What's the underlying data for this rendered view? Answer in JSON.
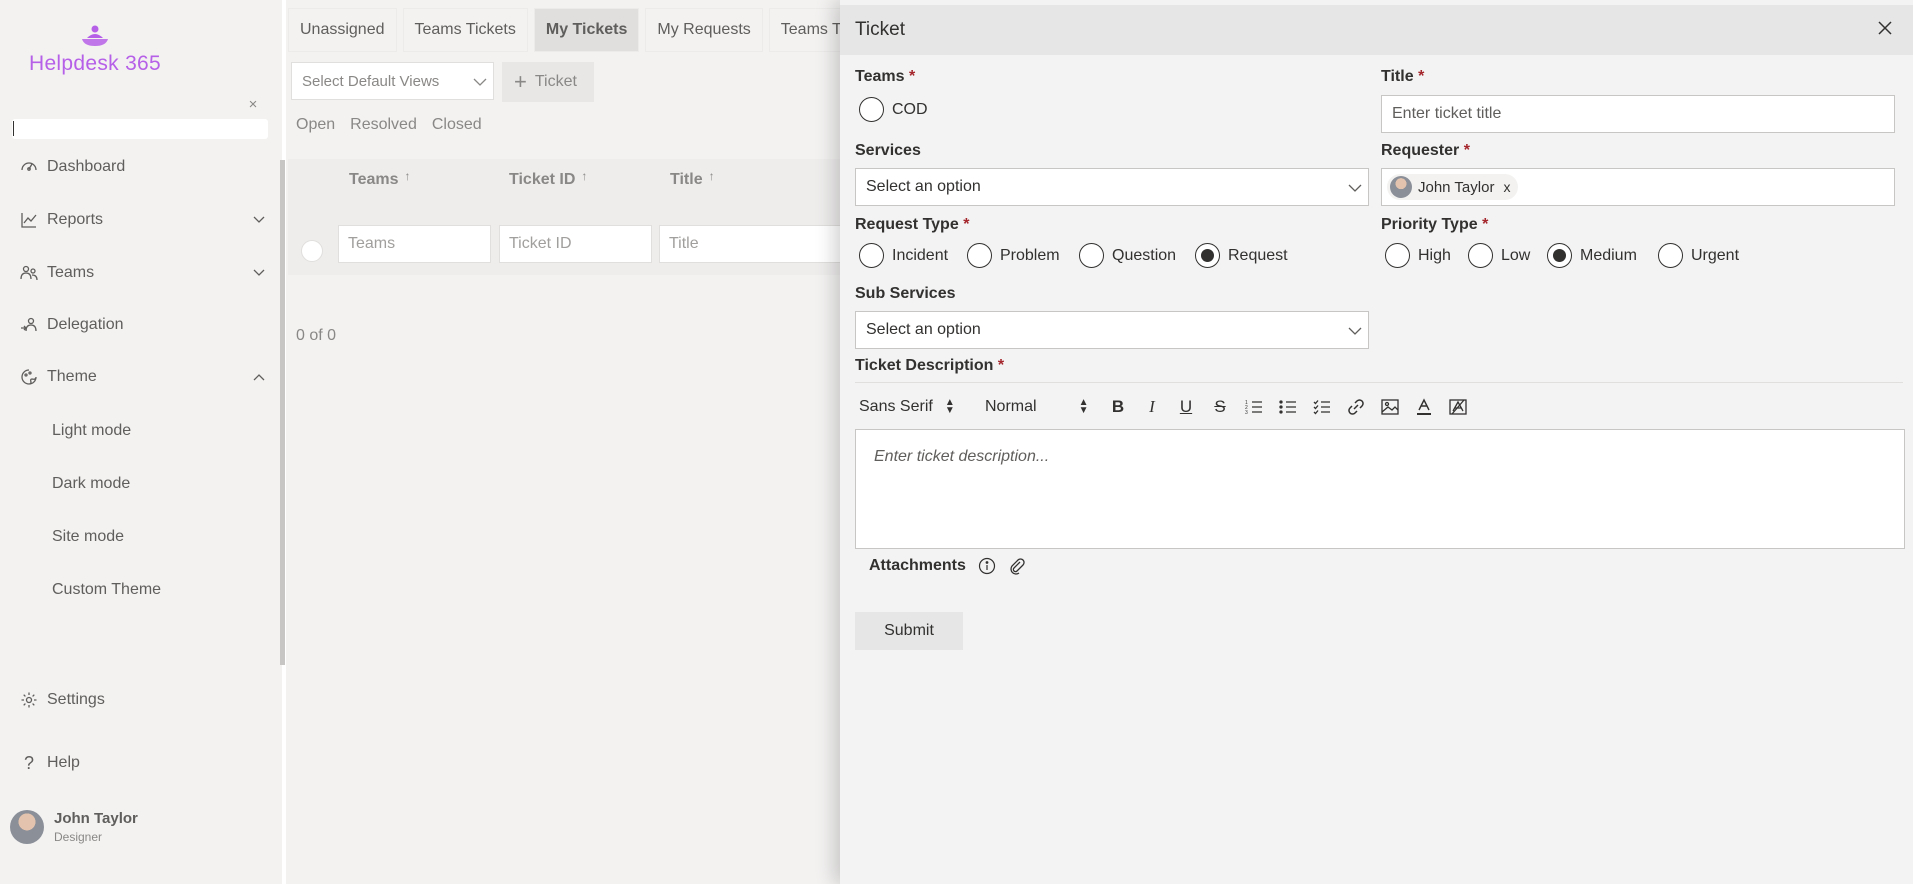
{
  "sidebar": {
    "logo_text": "Helpdesk 365",
    "nav": [
      {
        "label": "Dashboard",
        "icon": "dashboard-icon"
      },
      {
        "label": "Reports",
        "icon": "reports-icon"
      },
      {
        "label": "Teams",
        "icon": "teams-icon"
      },
      {
        "label": "Delegation",
        "icon": "delegation-icon"
      },
      {
        "label": "Theme",
        "icon": "theme-icon"
      }
    ],
    "theme_items": [
      "Light mode",
      "Dark mode",
      "Site mode",
      "Custom Theme"
    ],
    "settings_label": "Settings",
    "help_label": "Help",
    "user": {
      "name": "John Taylor",
      "role": "Designer"
    }
  },
  "main": {
    "tabs": [
      "Unassigned",
      "Teams Tickets",
      "My Tickets",
      "My Requests",
      "Teams Ta"
    ],
    "active_tab": "My Tickets",
    "views_placeholder": "Select Default Views",
    "add_ticket_label": "Ticket",
    "filters": [
      "Open",
      "Resolved",
      "Closed"
    ],
    "columns": [
      "Teams",
      "Ticket ID",
      "Title"
    ],
    "column_filters": [
      "Teams",
      "Ticket ID",
      "Title"
    ],
    "pager": "0 of 0"
  },
  "panel": {
    "title": "Ticket",
    "teams_label": "Teams",
    "teams_options": [
      "COD"
    ],
    "title_label": "Title",
    "title_placeholder": "Enter ticket title",
    "services_label": "Services",
    "services_placeholder": "Select an option",
    "requester_label": "Requester",
    "requester_value": "John Taylor",
    "requester_remove": "x",
    "request_type_label": "Request Type",
    "request_types": [
      "Incident",
      "Problem",
      "Question",
      "Request"
    ],
    "request_type_selected": "Request",
    "priority_label": "Priority Type",
    "priorities": [
      "High",
      "Low",
      "Medium",
      "Urgent"
    ],
    "priority_selected": "Medium",
    "sub_services_label": "Sub Services",
    "sub_services_placeholder": "Select an option",
    "description_label": "Ticket Description",
    "toolbar": {
      "font": "Sans Serif",
      "size": "Normal"
    },
    "description_placeholder": "Enter ticket description...",
    "attachments_label": "Attachments",
    "submit_label": "Submit",
    "required_mark": "*"
  },
  "colors": {
    "brand": "#b660e8",
    "required": "#a4262c"
  }
}
